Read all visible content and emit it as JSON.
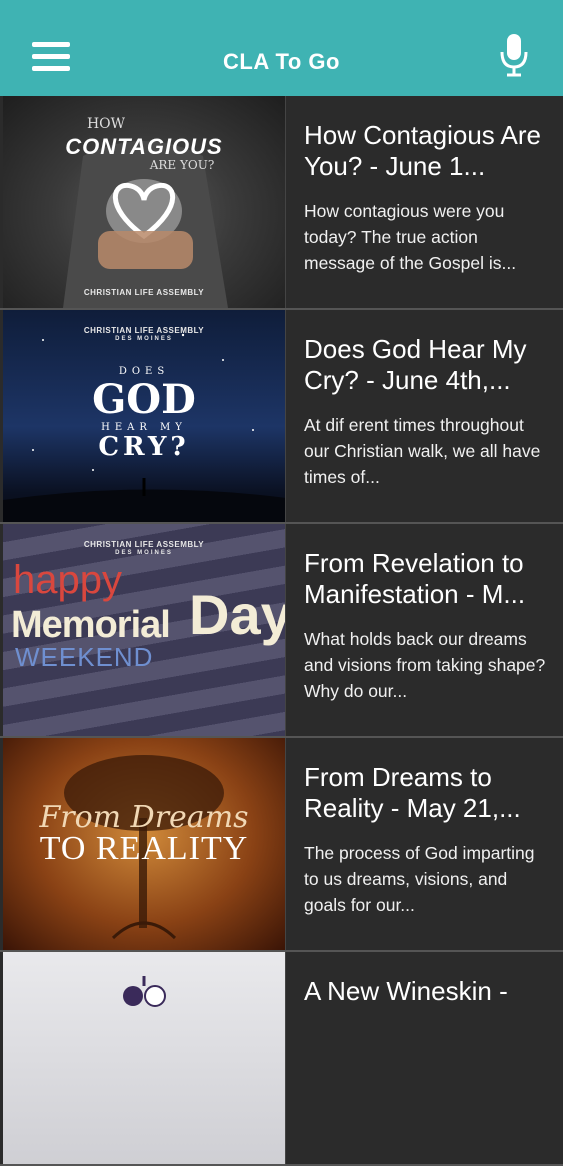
{
  "header": {
    "title": "CLA To Go",
    "menu_icon": "hamburger-menu-icon",
    "mic_icon": "microphone-icon",
    "background_color": "#3fb3b3"
  },
  "items": [
    {
      "title": "How Contagious Are You? - June 1...",
      "description": "How contagious were you today? The true action message of the Gospel is...",
      "art": {
        "line1": "HOW",
        "line2": "CONTAGIOUS",
        "line3": "ARE YOU?",
        "brand": "CHRISTIAN LIFE ASSEMBLY"
      }
    },
    {
      "title": "Does God Hear My Cry? - June 4th,...",
      "description": "At dif erent times throughout our Christian walk, we all have times of...",
      "art": {
        "brand": "CHRISTIAN LIFE ASSEMBLY",
        "brand_sub": "DES MOINES",
        "line1": "DOES",
        "line2": "GOD",
        "line3": "HEAR MY",
        "line4": "CRY?"
      }
    },
    {
      "title": "From Revelation to Manifestation - M...",
      "description": "What holds back our dreams and visions from taking shape? Why do our...",
      "art": {
        "brand": "CHRISTIAN LIFE ASSEMBLY",
        "brand_sub": "DES MOINES",
        "line1": "happy",
        "line2": "Memorial",
        "line3": "Day",
        "line4": "WEEKEND"
      }
    },
    {
      "title": "From Dreams to Reality - May 21,...",
      "description": "The process of God imparting to us dreams, visions, and goals for our...",
      "art": {
        "line1": "From Dreams",
        "line2": "TO REALITY"
      }
    },
    {
      "title": "A New Wineskin -",
      "description": "",
      "art": {}
    }
  ]
}
